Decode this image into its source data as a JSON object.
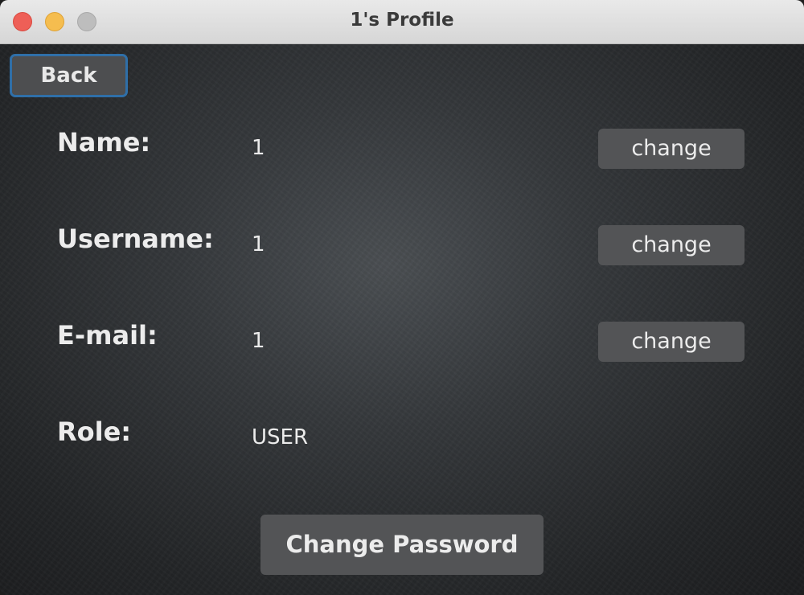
{
  "window": {
    "title": "1's Profile"
  },
  "nav": {
    "back_label": "Back"
  },
  "profile": {
    "fields": [
      {
        "label": "Name:",
        "value": "1",
        "action": "change"
      },
      {
        "label": "Username:",
        "value": "1",
        "action": "change"
      },
      {
        "label": "E-mail:",
        "value": "1",
        "action": "change"
      },
      {
        "label": "Role:",
        "value": "USER"
      }
    ]
  },
  "actions": {
    "change_password_label": "Change Password"
  },
  "colors": {
    "close": "#ee5f57",
    "minimize": "#f5bd4f",
    "zoom": "#bdbdbd",
    "focus_ring": "#2f6fa8",
    "button_bg": "#535456"
  }
}
